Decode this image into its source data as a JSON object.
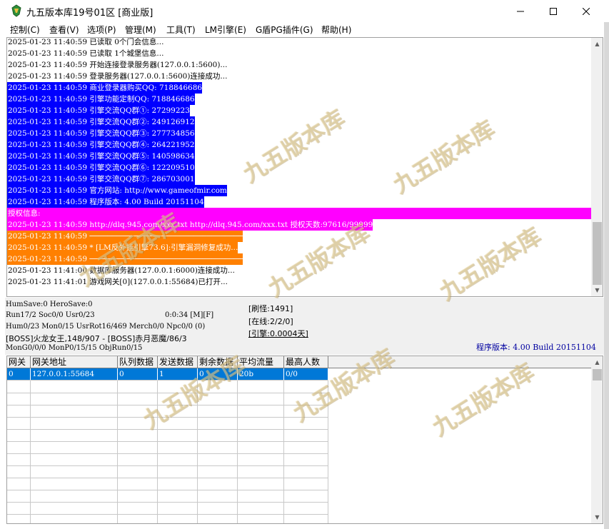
{
  "window": {
    "title": "九五版本库19号01区 [商业版]"
  },
  "menu": [
    "控制(C)",
    "查看(V)",
    "选项(P)",
    "管理(M)",
    "工具(T)",
    "LM引擎(E)",
    "G盾PG插件(G)",
    "帮助(H)"
  ],
  "log": [
    {
      "text": "2025-01-23 11:40:59 已读取 0个门会信息...",
      "style": "none"
    },
    {
      "text": "2025-01-23 11:40:59 已读取 1个城堡信息...",
      "style": "none"
    },
    {
      "text": "2025-01-23 11:40:59 开始连接登录服务器(127.0.0.1:5600)...",
      "style": "none"
    },
    {
      "text": "2025-01-23 11:40:59 登录服务器(127.0.0.1:5600)连接成功...",
      "style": "none"
    },
    {
      "text": "2025-01-23 11:40:59 商业登录器购买QQ: 718846686",
      "style": "blue"
    },
    {
      "text": "2025-01-23 11:40:59 引擎功能定制QQ: 718846686",
      "style": "blue"
    },
    {
      "text": "2025-01-23 11:40:59 引擎交流QQ群①: 27299223",
      "style": "blue"
    },
    {
      "text": "2025-01-23 11:40:59 引擎交流QQ群②: 249126912",
      "style": "blue"
    },
    {
      "text": "2025-01-23 11:40:59 引擎交流QQ群③: 277734856",
      "style": "blue"
    },
    {
      "text": "2025-01-23 11:40:59 引擎交流QQ群④: 264221952",
      "style": "blue"
    },
    {
      "text": "2025-01-23 11:40:59 引擎交流QQ群⑤: 140598634",
      "style": "blue"
    },
    {
      "text": "2025-01-23 11:40:59 引擎交流QQ群⑥: 122209510",
      "style": "blue"
    },
    {
      "text": "2025-01-23 11:40:59 引擎交流QQ群⑦: 286703001",
      "style": "blue"
    },
    {
      "text": "2025-01-23 11:40:59 官方网站: http://www.gameofmir.com",
      "style": "blue"
    },
    {
      "text": "2025-01-23 11:40:59 程序版本: 4.00 Build 20151104",
      "style": "blue"
    },
    {
      "text": "授权信息:",
      "style": "magenta"
    },
    {
      "text": "2025-01-23 11:40:59 http://dlq.945.com/xxx.txt http://dlq.945.com/xxx.txt 授权天数:97616/99999",
      "style": "magenta"
    },
    {
      "text": "2025-01-23 11:40:59 ──────────────────────────────────",
      "style": "orange"
    },
    {
      "text": "2025-01-23 11:40:59 * [LM反外挂引擎73.6]:引擎漏洞修复成功...",
      "style": "orange"
    },
    {
      "text": "2025-01-23 11:40:59 ──────────────────────────────────",
      "style": "orange"
    },
    {
      "text": "2025-01-23 11:41:00 数据库服务器(127.0.0.1:6000)连接成功...",
      "style": "none"
    },
    {
      "text": "2025-01-23 11:41:01 游戏网关[0](127.0.0.1:55684)已打开...",
      "style": "none"
    }
  ],
  "status": {
    "line1": "HumSave:0 HeroSave:0",
    "line2": "Run17/2 Soc0/0 Usr0/23",
    "timer": "0:0:34 [M][F]",
    "line3": "Hum0/23 Mon0/15 UsrRot16/469 Merch0/0 Npc0/0 (0)",
    "line4": "[BOSS]火龙女王,148/907 - [BOSS]赤月恶魔/86/3",
    "line5": "MonG0/0/0 MonP0/15/15 ObjRun0/15",
    "refresh": "[刷怪:1491]",
    "online": "[在线:2/2/0]",
    "engine": "[引擎:0.0004天]",
    "version": "程序版本: 4.00 Build 20151104"
  },
  "grid": {
    "columns": [
      "网关",
      "网关地址",
      "队列数据",
      "发送数据",
      "剩余数据",
      "平均流量",
      "最高人数"
    ],
    "rows": [
      [
        "0",
        "127.0.0.1:55684",
        "0",
        "1",
        "0",
        "20b",
        "0/0"
      ]
    ]
  },
  "watermark": "九五版本库",
  "colors": {
    "blue_highlight": "#0000ff",
    "magenta_highlight": "#ff00ff",
    "orange_highlight": "#ff8000",
    "selection": "#0078d7",
    "version_text": "#0000a0"
  }
}
